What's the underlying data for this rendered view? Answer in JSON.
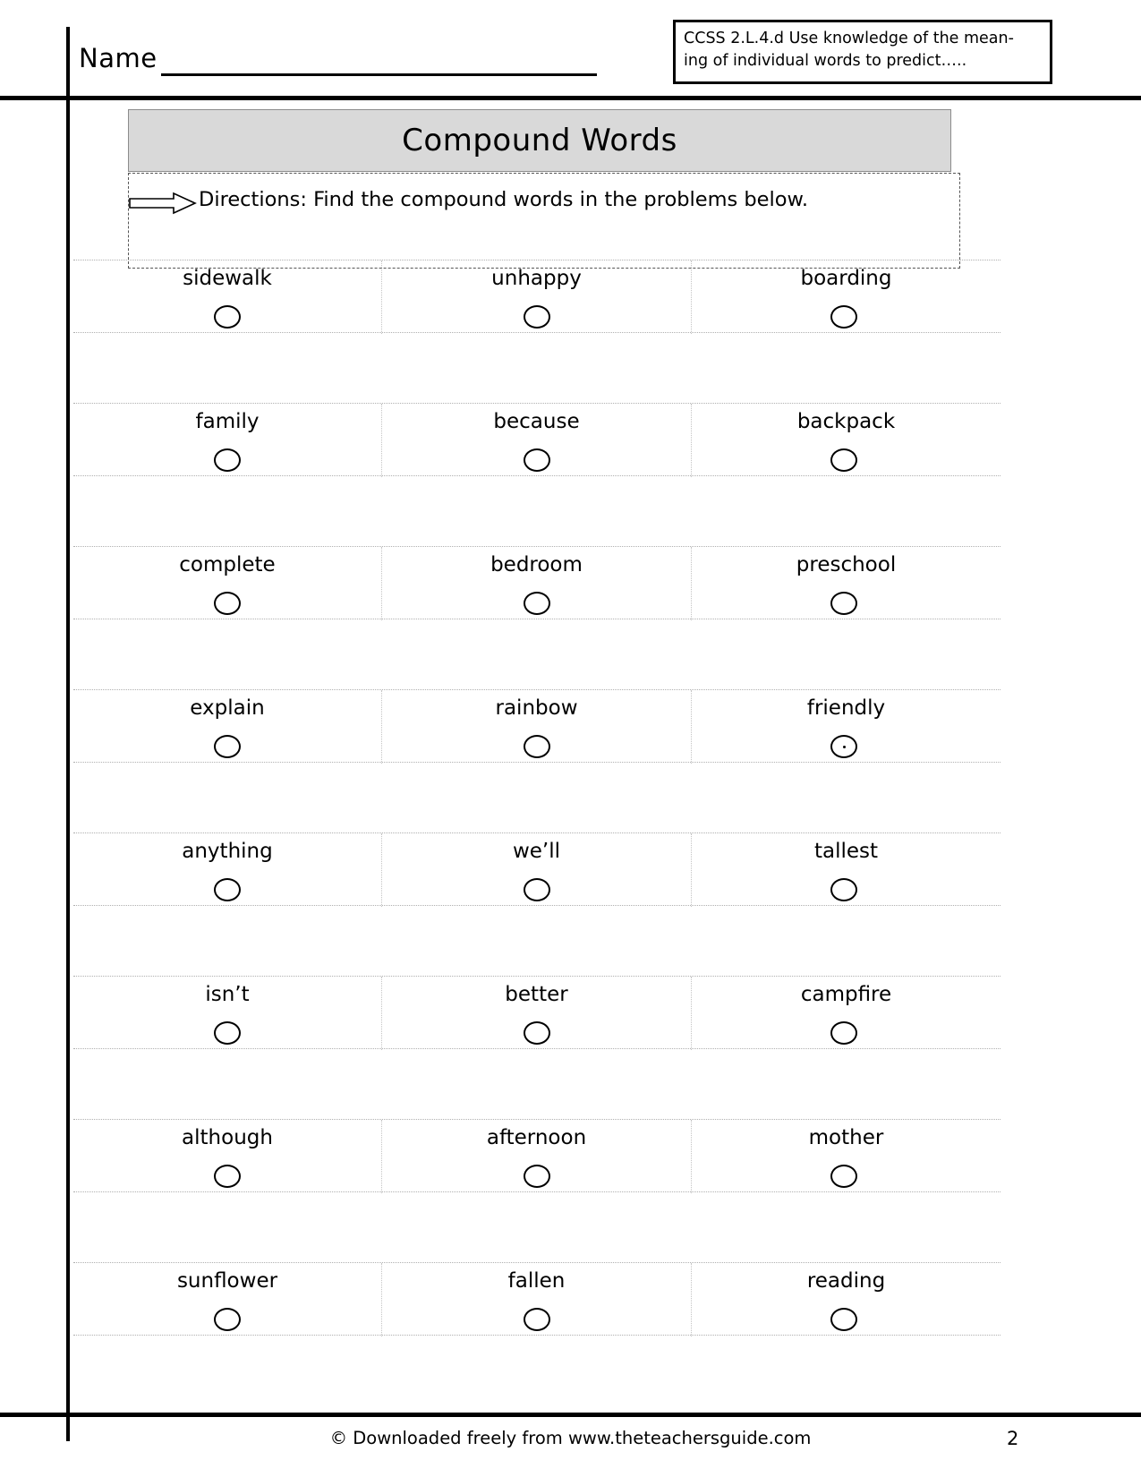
{
  "header": {
    "name_label": "Name",
    "ccss_line1": "CCSS 2.L.4.d  Use knowledge of the mean-",
    "ccss_line2": "ing of individual words to predict….."
  },
  "title": "Compound Words",
  "directions": {
    "text": "Directions:  Find the compound words in the problems below.",
    "arrow_icon": "right-arrow-outline-icon"
  },
  "grid": {
    "columns": 3,
    "rows": [
      {
        "cells": [
          {
            "word": "sidewalk",
            "marked": false
          },
          {
            "word": "unhappy",
            "marked": false
          },
          {
            "word": "boarding",
            "marked": false
          }
        ]
      },
      {
        "cells": [
          {
            "word": "family",
            "marked": false
          },
          {
            "word": "because",
            "marked": false
          },
          {
            "word": "backpack",
            "marked": false
          }
        ]
      },
      {
        "cells": [
          {
            "word": "complete",
            "marked": false
          },
          {
            "word": "bedroom",
            "marked": false
          },
          {
            "word": "preschool",
            "marked": false
          }
        ]
      },
      {
        "cells": [
          {
            "word": "explain",
            "marked": false
          },
          {
            "word": "rainbow",
            "marked": false
          },
          {
            "word": "friendly",
            "marked": true
          }
        ]
      },
      {
        "cells": [
          {
            "word": "anything",
            "marked": false
          },
          {
            "word": "we’ll",
            "marked": false
          },
          {
            "word": "tallest",
            "marked": false
          }
        ]
      },
      {
        "cells": [
          {
            "word": "isn’t",
            "marked": false
          },
          {
            "word": "better",
            "marked": false
          },
          {
            "word": "campfire",
            "marked": false
          }
        ]
      },
      {
        "cells": [
          {
            "word": "although",
            "marked": false
          },
          {
            "word": "afternoon",
            "marked": false
          },
          {
            "word": "mother",
            "marked": false
          }
        ]
      },
      {
        "cells": [
          {
            "word": "sunflower",
            "marked": false
          },
          {
            "word": "fallen",
            "marked": false
          },
          {
            "word": "reading",
            "marked": false
          }
        ]
      }
    ]
  },
  "footer": {
    "credit": "© Downloaded freely from www.theteachersguide.com",
    "page_number": "2"
  },
  "colors": {
    "banner_fill": "#d9d9d9",
    "rule": "#000000",
    "dotted": "#b0b0b0"
  }
}
